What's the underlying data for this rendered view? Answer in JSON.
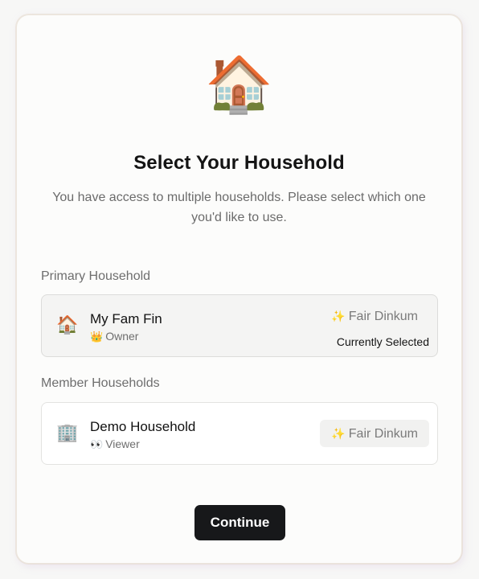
{
  "hero": {
    "icon": "🏠",
    "icon_name": "house-with-garden-icon"
  },
  "title": "Select Your Household",
  "subtitle": "You have access to multiple households. Please select which one you'd like to use.",
  "primary": {
    "section_label": "Primary Household",
    "household": {
      "icon": "🏠",
      "name": "My Fam Fin",
      "role_icon": "👑",
      "role": "Owner",
      "tag_icon": "✨",
      "tag": "Fair Dinkum",
      "status": "Currently Selected"
    }
  },
  "members": {
    "section_label": "Member Households",
    "household": {
      "icon": "🏢",
      "name": "Demo Household",
      "role_icon": "👀",
      "role": "Viewer",
      "tag_icon": "✨",
      "tag": "Fair Dinkum"
    }
  },
  "continue_label": "Continue"
}
